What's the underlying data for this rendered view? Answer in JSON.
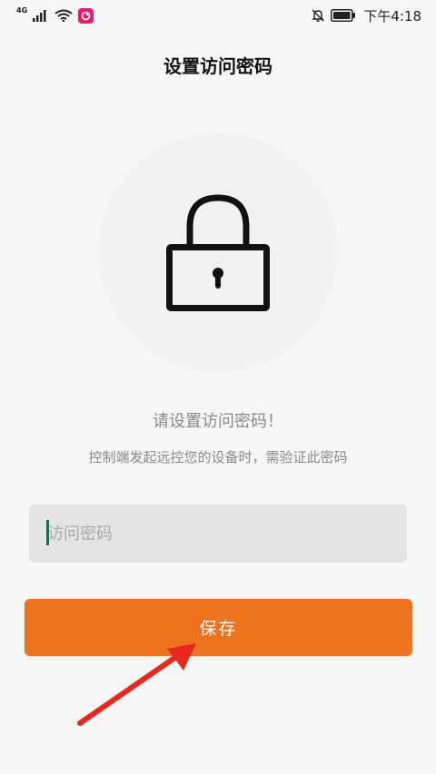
{
  "status_bar": {
    "network_type": "4G",
    "time": "下午4:18",
    "icons": [
      "signal-icon",
      "wifi-icon",
      "app-notification-icon",
      "mute-icon",
      "battery-icon"
    ]
  },
  "page": {
    "title": "设置访问密码"
  },
  "lock": {
    "icon": "lock-icon"
  },
  "prompt": {
    "title": "请设置访问密码！",
    "description": "控制端发起远控您的设备时，需验证此密码"
  },
  "password": {
    "placeholder": "访问密码",
    "value": ""
  },
  "save_button": {
    "label": "保存"
  },
  "colors": {
    "accent": "#ef721f",
    "background": "#f6f6f6",
    "annotation_arrow": "#e8281c",
    "cursor": "#0f6b63"
  }
}
